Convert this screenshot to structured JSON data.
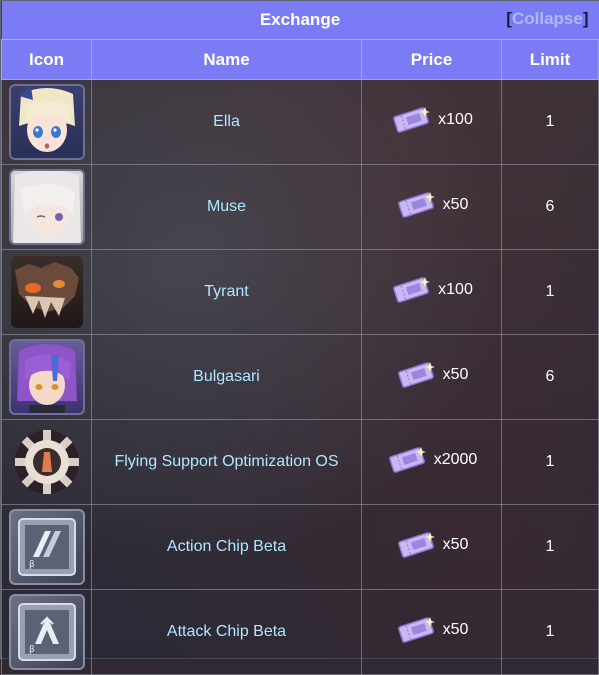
{
  "table": {
    "title": "Exchange",
    "collapse_bracket_open": "[",
    "collapse_label": "Collapse",
    "collapse_bracket_close": "]",
    "headers": {
      "icon": "Icon",
      "name": "Name",
      "price": "Price",
      "limit": "Limit"
    },
    "rows": [
      {
        "name": "Ella",
        "price": "x100",
        "limit": "1",
        "icon": "ella-portrait-icon"
      },
      {
        "name": "Muse",
        "price": "x50",
        "limit": "6",
        "icon": "muse-portrait-icon"
      },
      {
        "name": "Tyrant",
        "price": "x100",
        "limit": "1",
        "icon": "tyrant-portrait-icon"
      },
      {
        "name": "Bulgasari",
        "price": "x50",
        "limit": "6",
        "icon": "bulgasari-portrait-icon"
      },
      {
        "name": "Flying Support Optimization OS",
        "price": "x2000",
        "limit": "1",
        "icon": "gear-os-icon"
      },
      {
        "name": "Action Chip Beta",
        "price": "x50",
        "limit": "1",
        "icon": "action-chip-icon"
      },
      {
        "name": "Attack Chip Beta",
        "price": "x50",
        "limit": "1",
        "icon": "attack-chip-icon"
      }
    ]
  },
  "currency_icon": "ticket-icon"
}
